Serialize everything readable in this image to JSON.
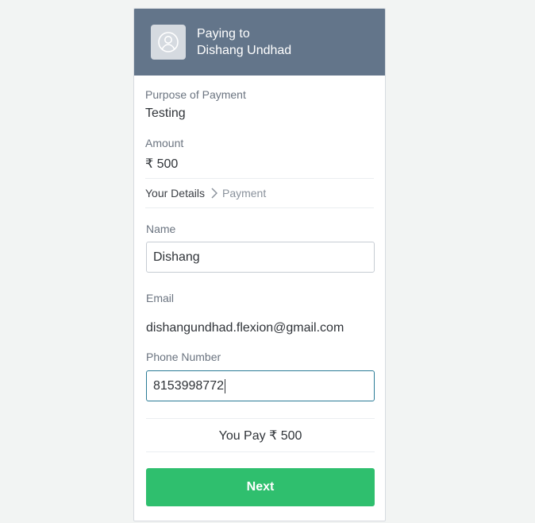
{
  "header": {
    "line1": "Paying to",
    "line2": "Dishang Undhad",
    "avatar_icon": "user-circle-icon"
  },
  "purpose": {
    "label": "Purpose of Payment",
    "value": "Testing"
  },
  "amount": {
    "label": "Amount",
    "value": "₹ 500"
  },
  "steps": {
    "current": "Your Details",
    "next": "Payment",
    "separator_icon": "chevron-right-icon"
  },
  "form": {
    "name": {
      "label": "Name",
      "value": "Dishang"
    },
    "email": {
      "label": "Email",
      "value": "dishangundhad.flexion@gmail.com"
    },
    "phone": {
      "label": "Phone Number",
      "value": "8153998772"
    }
  },
  "summary": {
    "text": "You Pay ₹ 500"
  },
  "actions": {
    "next_label": "Next"
  },
  "colors": {
    "header_bg": "#63758a",
    "button_bg": "#2fbf6e",
    "focus_border": "#2a7b96",
    "page_bg": "#f2f4f3"
  }
}
